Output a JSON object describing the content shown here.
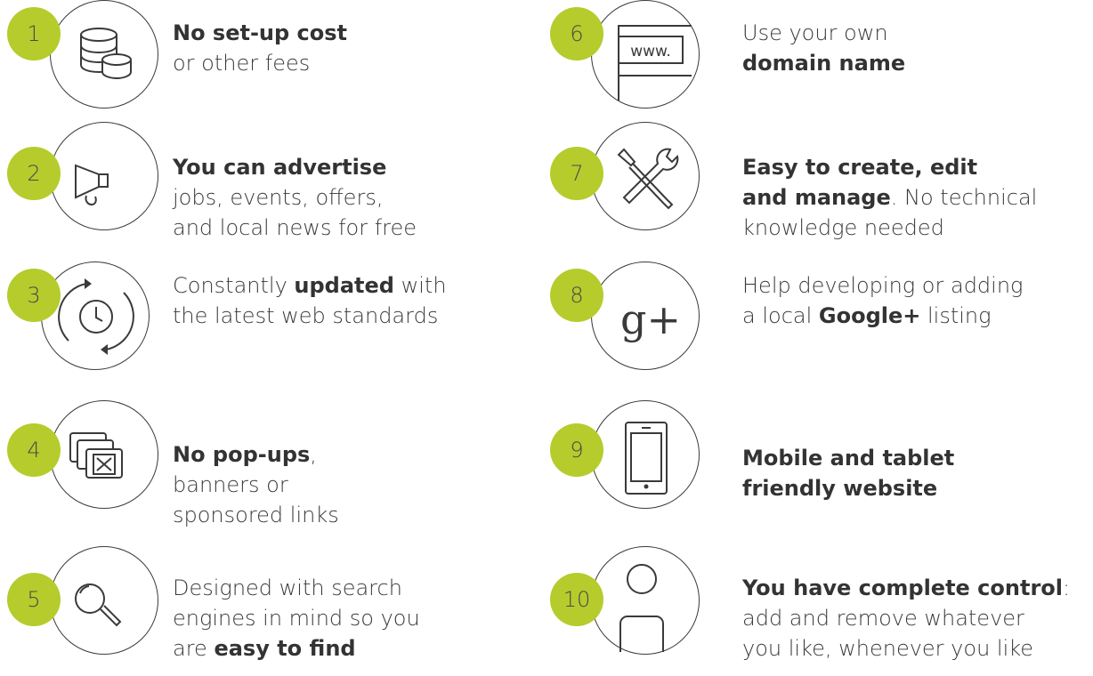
{
  "colors": {
    "badge": "#b5cc2c",
    "icon_stroke": "#3a3a3a",
    "text": "#333333"
  },
  "features": [
    {
      "number": "1",
      "icon": "coins-stack-icon",
      "lines": [
        [
          {
            "t": "No set-up cost",
            "b": true
          }
        ],
        [
          {
            "t": "or other fees",
            "b": false
          }
        ]
      ]
    },
    {
      "number": "2",
      "icon": "megaphone-icon",
      "lines": [
        [
          {
            "t": "You can advertise",
            "b": true
          }
        ],
        [
          {
            "t": "jobs, events, offers,",
            "b": false
          }
        ],
        [
          {
            "t": "and local news for free",
            "b": false
          }
        ]
      ]
    },
    {
      "number": "3",
      "icon": "clock-refresh-icon",
      "lines": [
        [
          {
            "t": "Constantly ",
            "b": false
          },
          {
            "t": "updated",
            "b": true
          },
          {
            "t": " with",
            "b": false
          }
        ],
        [
          {
            "t": "the latest web standards",
            "b": false
          }
        ]
      ]
    },
    {
      "number": "4",
      "icon": "popup-close-icon",
      "lines": [
        [
          {
            "t": "No pop-ups",
            "b": true
          },
          {
            "t": ",",
            "b": false
          }
        ],
        [
          {
            "t": "banners or",
            "b": false
          }
        ],
        [
          {
            "t": "sponsored links",
            "b": false
          }
        ]
      ]
    },
    {
      "number": "5",
      "icon": "magnifier-icon",
      "lines": [
        [
          {
            "t": "Designed with search",
            "b": false
          }
        ],
        [
          {
            "t": "engines in mind so you",
            "b": false
          }
        ],
        [
          {
            "t": "are ",
            "b": false
          },
          {
            "t": "easy to find",
            "b": true
          }
        ]
      ]
    },
    {
      "number": "6",
      "icon": "browser-www-icon",
      "icon_text": "www.",
      "lines": [
        [
          {
            "t": "Use your own",
            "b": false
          }
        ],
        [
          {
            "t": "domain name",
            "b": true
          }
        ]
      ]
    },
    {
      "number": "7",
      "icon": "tools-icon",
      "lines": [
        [
          {
            "t": "Easy to create, edit",
            "b": true
          }
        ],
        [
          {
            "t": "and manage",
            "b": true
          },
          {
            "t": ".  No technical",
            "b": false
          }
        ],
        [
          {
            "t": "knowledge needed",
            "b": false
          }
        ]
      ]
    },
    {
      "number": "8",
      "icon": "google-plus-icon",
      "icon_text": "g+",
      "lines": [
        [
          {
            "t": "Help developing or adding",
            "b": false
          }
        ],
        [
          {
            "t": "a local ",
            "b": false
          },
          {
            "t": "Google+",
            "b": true
          },
          {
            "t": " listing",
            "b": false
          }
        ]
      ]
    },
    {
      "number": "9",
      "icon": "tablet-icon",
      "lines": [
        [
          {
            "t": "Mobile and tablet",
            "b": true
          }
        ],
        [
          {
            "t": "friendly website",
            "b": true
          }
        ]
      ]
    },
    {
      "number": "10",
      "icon": "user-icon",
      "lines": [
        [
          {
            "t": "You have complete control",
            "b": true
          },
          {
            "t": ":",
            "b": false
          }
        ],
        [
          {
            "t": "add and remove whatever",
            "b": false
          }
        ],
        [
          {
            "t": "you like, whenever you like",
            "b": false
          }
        ]
      ]
    }
  ]
}
